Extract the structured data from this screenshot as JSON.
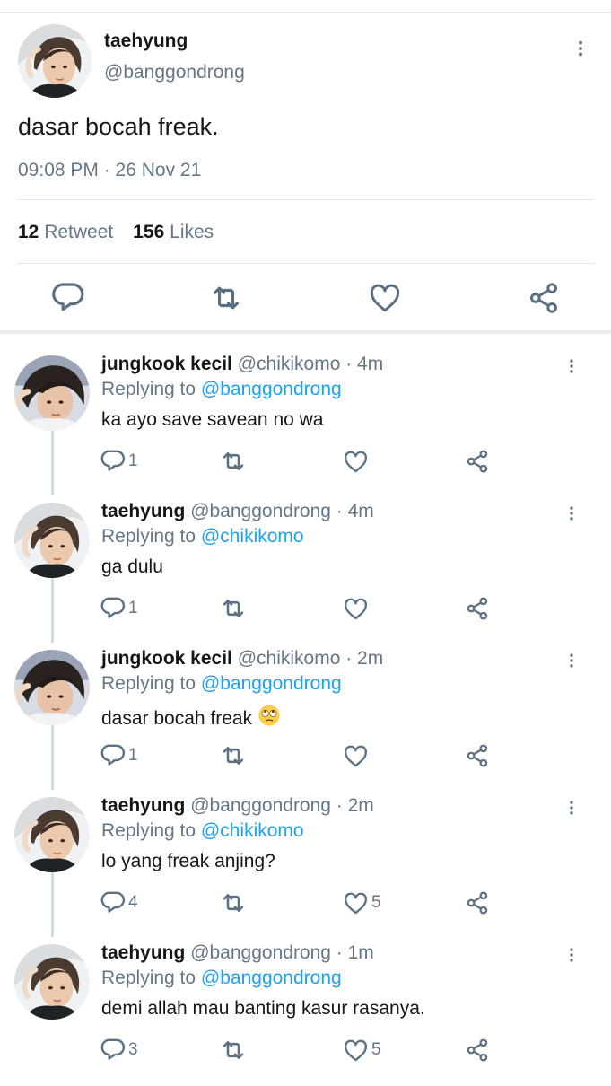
{
  "main_tweet": {
    "name": "taehyung",
    "handle": "@banggondrong",
    "text": "dasar bocah freak.",
    "timestamp": "09:08 PM · 26 Nov 21",
    "retweets_count": "12",
    "retweets_label": "Retweet",
    "likes_count": "156",
    "likes_label": "Likes",
    "actions": [
      "reply-icon",
      "retweet-icon",
      "like-icon",
      "share-icon"
    ]
  },
  "replies": [
    {
      "name": "jungkook kecil",
      "handle": "@chikikomo · 4m",
      "replying_prefix": "Replying to",
      "replying_to": "@banggondrong",
      "text": "ka ayo save savean no wa",
      "emoji": "",
      "reply_count": "1",
      "retweet_count": "",
      "like_count": ""
    },
    {
      "name": "taehyung",
      "handle": "@banggondrong · 4m",
      "replying_prefix": "Replying to",
      "replying_to": "@chikikomo",
      "text": "ga dulu",
      "emoji": "",
      "reply_count": "1",
      "retweet_count": "",
      "like_count": ""
    },
    {
      "name": "jungkook kecil",
      "handle": "@chikikomo · 2m",
      "replying_prefix": "Replying to",
      "replying_to": "@banggondrong",
      "text": "dasar bocah freak",
      "emoji": "rolling-eyes-emoji",
      "reply_count": "1",
      "retweet_count": "",
      "like_count": ""
    },
    {
      "name": "taehyung",
      "handle": "@banggondrong · 2m",
      "replying_prefix": "Replying to",
      "replying_to": "@chikikomo",
      "text": "lo yang freak anjing?",
      "emoji": "",
      "reply_count": "4",
      "retweet_count": "",
      "like_count": "5"
    },
    {
      "name": "taehyung",
      "handle": "@banggondrong · 1m",
      "replying_prefix": "Replying to",
      "replying_to": "@banggondrong",
      "text": "demi allah mau banting kasur rasanya.",
      "emoji": "",
      "reply_count": "3",
      "retweet_count": "",
      "like_count": "5"
    }
  ],
  "colors": {
    "link": "#1da1f2",
    "muted": "#657786",
    "text": "#14171a",
    "divider": "#e1e5e8",
    "icon": "#5b7083"
  }
}
